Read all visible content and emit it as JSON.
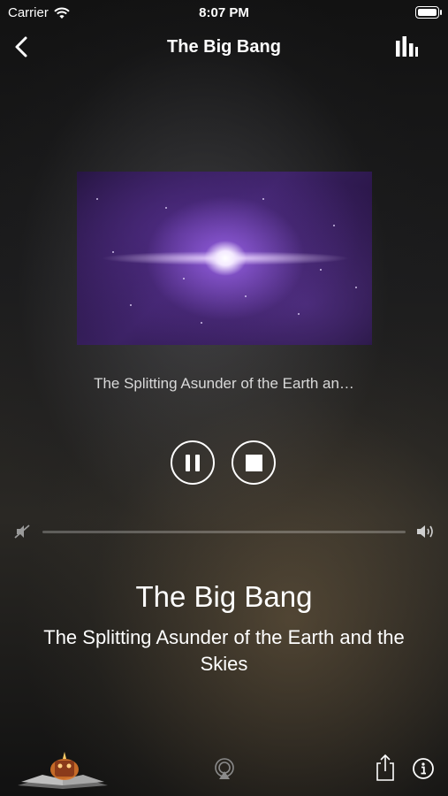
{
  "status_bar": {
    "carrier": "Carrier",
    "time": "8:07 PM"
  },
  "nav": {
    "title": "The Big Bang",
    "back_icon": "chevron-left-icon",
    "equalizer_icon": "equalizer-icon"
  },
  "player": {
    "track_line": "The Splitting Asunder of the Earth an…",
    "pause_icon": "pause-icon",
    "stop_icon": "stop-icon",
    "volume_level": 0
  },
  "now_playing": {
    "title": "The Big Bang",
    "subtitle": "The Splitting Asunder of the Earth and the Skies"
  },
  "bottom_bar": {
    "airplay_icon": "airplay-icon",
    "share_icon": "share-icon",
    "info_icon": "info-icon"
  },
  "colors": {
    "text": "#ffffff",
    "artwork_glow": "#b88cff"
  }
}
